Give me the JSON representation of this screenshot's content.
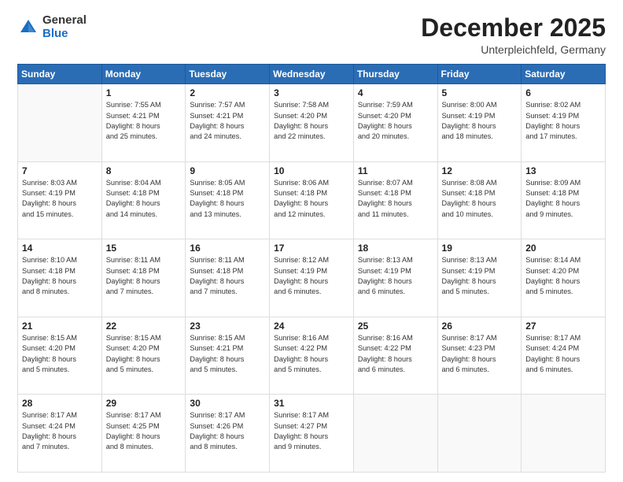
{
  "logo": {
    "general": "General",
    "blue": "Blue"
  },
  "header": {
    "month": "December 2025",
    "location": "Unterpleichfeld, Germany"
  },
  "weekdays": [
    "Sunday",
    "Monday",
    "Tuesday",
    "Wednesday",
    "Thursday",
    "Friday",
    "Saturday"
  ],
  "weeks": [
    [
      {
        "day": "",
        "info": ""
      },
      {
        "day": "1",
        "info": "Sunrise: 7:55 AM\nSunset: 4:21 PM\nDaylight: 8 hours\nand 25 minutes."
      },
      {
        "day": "2",
        "info": "Sunrise: 7:57 AM\nSunset: 4:21 PM\nDaylight: 8 hours\nand 24 minutes."
      },
      {
        "day": "3",
        "info": "Sunrise: 7:58 AM\nSunset: 4:20 PM\nDaylight: 8 hours\nand 22 minutes."
      },
      {
        "day": "4",
        "info": "Sunrise: 7:59 AM\nSunset: 4:20 PM\nDaylight: 8 hours\nand 20 minutes."
      },
      {
        "day": "5",
        "info": "Sunrise: 8:00 AM\nSunset: 4:19 PM\nDaylight: 8 hours\nand 18 minutes."
      },
      {
        "day": "6",
        "info": "Sunrise: 8:02 AM\nSunset: 4:19 PM\nDaylight: 8 hours\nand 17 minutes."
      }
    ],
    [
      {
        "day": "7",
        "info": "Sunrise: 8:03 AM\nSunset: 4:19 PM\nDaylight: 8 hours\nand 15 minutes."
      },
      {
        "day": "8",
        "info": "Sunrise: 8:04 AM\nSunset: 4:18 PM\nDaylight: 8 hours\nand 14 minutes."
      },
      {
        "day": "9",
        "info": "Sunrise: 8:05 AM\nSunset: 4:18 PM\nDaylight: 8 hours\nand 13 minutes."
      },
      {
        "day": "10",
        "info": "Sunrise: 8:06 AM\nSunset: 4:18 PM\nDaylight: 8 hours\nand 12 minutes."
      },
      {
        "day": "11",
        "info": "Sunrise: 8:07 AM\nSunset: 4:18 PM\nDaylight: 8 hours\nand 11 minutes."
      },
      {
        "day": "12",
        "info": "Sunrise: 8:08 AM\nSunset: 4:18 PM\nDaylight: 8 hours\nand 10 minutes."
      },
      {
        "day": "13",
        "info": "Sunrise: 8:09 AM\nSunset: 4:18 PM\nDaylight: 8 hours\nand 9 minutes."
      }
    ],
    [
      {
        "day": "14",
        "info": "Sunrise: 8:10 AM\nSunset: 4:18 PM\nDaylight: 8 hours\nand 8 minutes."
      },
      {
        "day": "15",
        "info": "Sunrise: 8:11 AM\nSunset: 4:18 PM\nDaylight: 8 hours\nand 7 minutes."
      },
      {
        "day": "16",
        "info": "Sunrise: 8:11 AM\nSunset: 4:18 PM\nDaylight: 8 hours\nand 7 minutes."
      },
      {
        "day": "17",
        "info": "Sunrise: 8:12 AM\nSunset: 4:19 PM\nDaylight: 8 hours\nand 6 minutes."
      },
      {
        "day": "18",
        "info": "Sunrise: 8:13 AM\nSunset: 4:19 PM\nDaylight: 8 hours\nand 6 minutes."
      },
      {
        "day": "19",
        "info": "Sunrise: 8:13 AM\nSunset: 4:19 PM\nDaylight: 8 hours\nand 5 minutes."
      },
      {
        "day": "20",
        "info": "Sunrise: 8:14 AM\nSunset: 4:20 PM\nDaylight: 8 hours\nand 5 minutes."
      }
    ],
    [
      {
        "day": "21",
        "info": "Sunrise: 8:15 AM\nSunset: 4:20 PM\nDaylight: 8 hours\nand 5 minutes."
      },
      {
        "day": "22",
        "info": "Sunrise: 8:15 AM\nSunset: 4:20 PM\nDaylight: 8 hours\nand 5 minutes."
      },
      {
        "day": "23",
        "info": "Sunrise: 8:15 AM\nSunset: 4:21 PM\nDaylight: 8 hours\nand 5 minutes."
      },
      {
        "day": "24",
        "info": "Sunrise: 8:16 AM\nSunset: 4:22 PM\nDaylight: 8 hours\nand 5 minutes."
      },
      {
        "day": "25",
        "info": "Sunrise: 8:16 AM\nSunset: 4:22 PM\nDaylight: 8 hours\nand 6 minutes."
      },
      {
        "day": "26",
        "info": "Sunrise: 8:17 AM\nSunset: 4:23 PM\nDaylight: 8 hours\nand 6 minutes."
      },
      {
        "day": "27",
        "info": "Sunrise: 8:17 AM\nSunset: 4:24 PM\nDaylight: 8 hours\nand 6 minutes."
      }
    ],
    [
      {
        "day": "28",
        "info": "Sunrise: 8:17 AM\nSunset: 4:24 PM\nDaylight: 8 hours\nand 7 minutes."
      },
      {
        "day": "29",
        "info": "Sunrise: 8:17 AM\nSunset: 4:25 PM\nDaylight: 8 hours\nand 8 minutes."
      },
      {
        "day": "30",
        "info": "Sunrise: 8:17 AM\nSunset: 4:26 PM\nDaylight: 8 hours\nand 8 minutes."
      },
      {
        "day": "31",
        "info": "Sunrise: 8:17 AM\nSunset: 4:27 PM\nDaylight: 8 hours\nand 9 minutes."
      },
      {
        "day": "",
        "info": ""
      },
      {
        "day": "",
        "info": ""
      },
      {
        "day": "",
        "info": ""
      }
    ]
  ]
}
